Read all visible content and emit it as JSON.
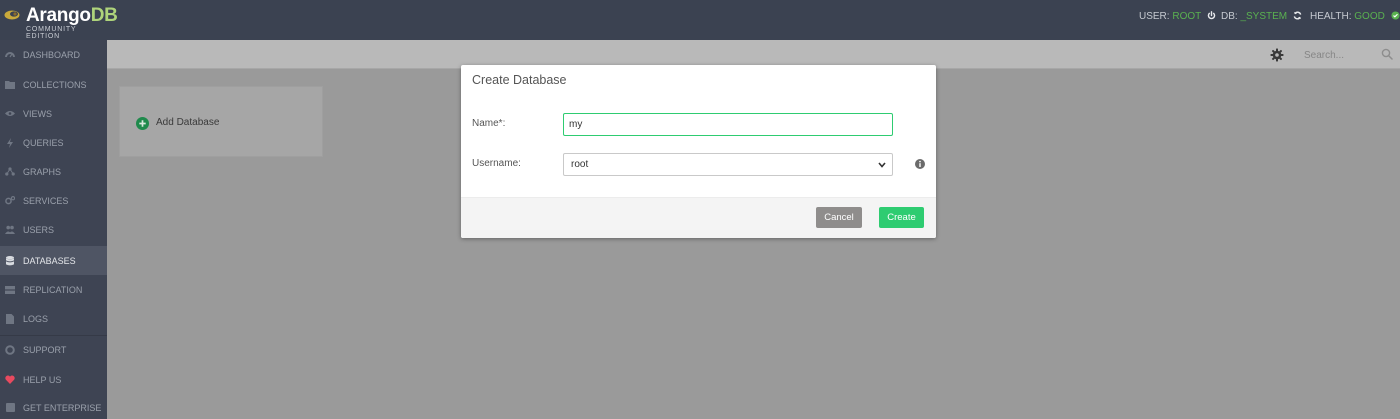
{
  "brand": {
    "name_part1": "Arango",
    "name_part2": "DB",
    "edition": "COMMUNITY EDITION"
  },
  "status": {
    "user_label": "USER:",
    "user_value": "ROOT",
    "db_label": "DB:",
    "db_value": "_SYSTEM",
    "health_label": "HEALTH:",
    "health_value": "GOOD"
  },
  "sidebar": {
    "items": [
      {
        "label": "DASHBOARD",
        "icon": "dashboard-icon"
      },
      {
        "label": "COLLECTIONS",
        "icon": "folder-icon"
      },
      {
        "label": "VIEWS",
        "icon": "eye-icon"
      },
      {
        "label": "QUERIES",
        "icon": "bolt-icon"
      },
      {
        "label": "GRAPHS",
        "icon": "graph-icon"
      },
      {
        "label": "SERVICES",
        "icon": "cogs-icon"
      },
      {
        "label": "USERS",
        "icon": "users-icon"
      },
      {
        "label": "DATABASES",
        "icon": "database-icon"
      },
      {
        "label": "REPLICATION",
        "icon": "server-icon"
      },
      {
        "label": "LOGS",
        "icon": "file-icon"
      },
      {
        "label": "SUPPORT",
        "icon": "lifebuoy-icon"
      },
      {
        "label": "HELP US",
        "icon": "heart-icon"
      },
      {
        "label": "GET ENTERPRISE",
        "icon": "square-icon"
      }
    ],
    "active": "DATABASES"
  },
  "header": {
    "search_placeholder": "Search..."
  },
  "tile": {
    "label": "Add Database"
  },
  "modal": {
    "title": "Create Database",
    "name_label": "Name*:",
    "name_value": "my",
    "username_label": "Username:",
    "username_value": "root",
    "cancel_label": "Cancel",
    "create_label": "Create"
  },
  "colors": {
    "accent": "#2ecc71",
    "topbar": "#3b4251",
    "sidebar": "#3e4453",
    "health_good": "#5ab150",
    "heart": "#e84a5f"
  }
}
